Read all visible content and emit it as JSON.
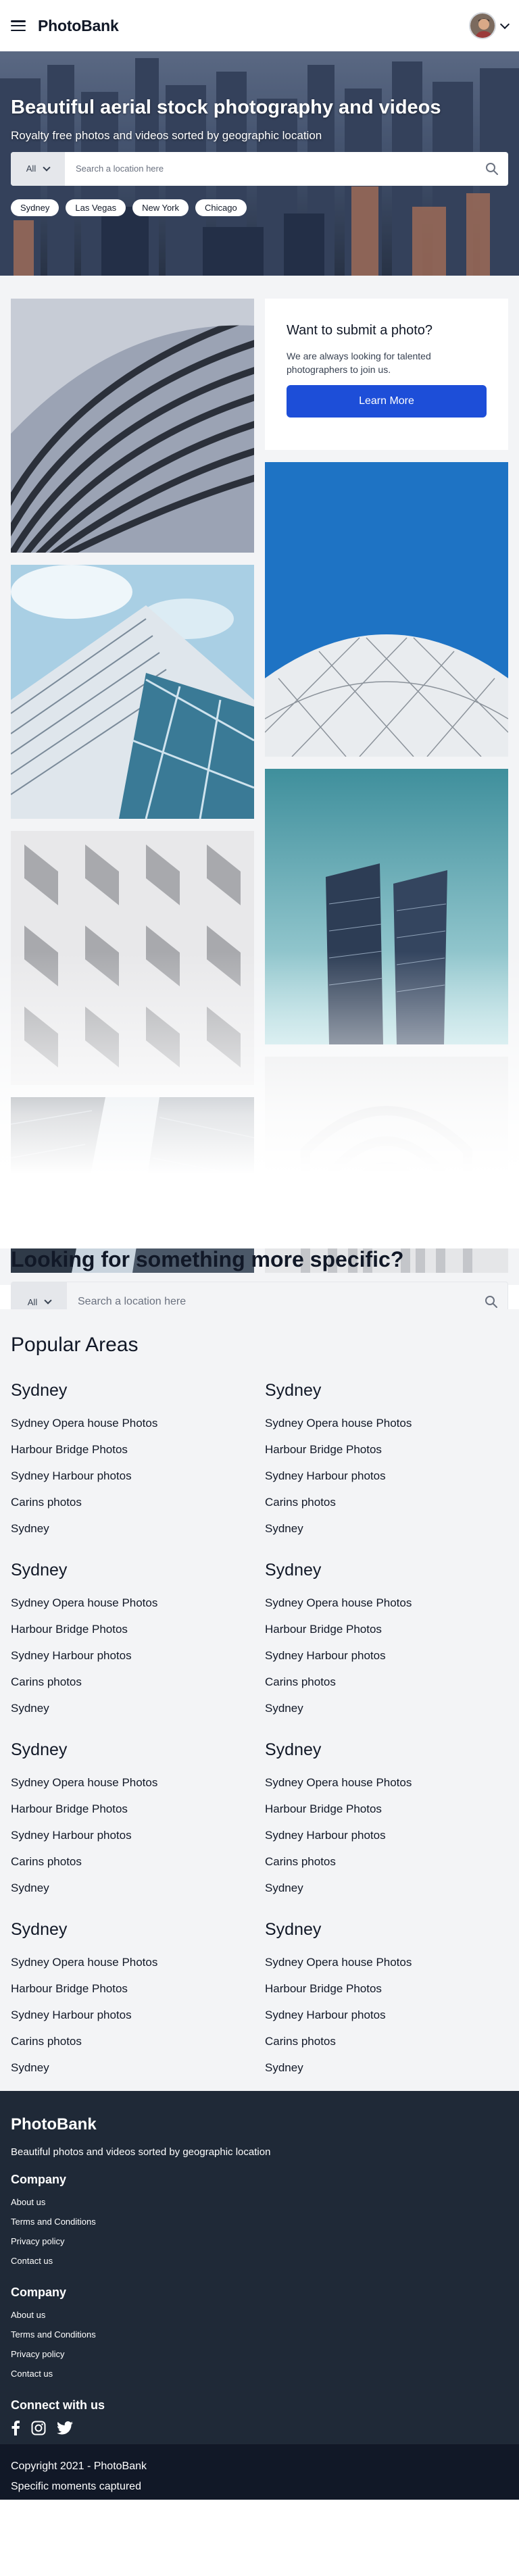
{
  "header": {
    "brand": "PhotoBank",
    "menu_icon": "hamburger-menu-icon",
    "avatar_icon": "user-avatar",
    "dropdown_icon": "chevron-down-icon"
  },
  "hero": {
    "title": "Beautiful aerial stock photography and videos",
    "subtitle": "Royalty free photos and videos sorted by geographic location",
    "search": {
      "category": "All",
      "placeholder": "Search a location here",
      "icon": "search-icon"
    },
    "chips": [
      "Sydney",
      "Las Vegas",
      "New York",
      "Chicago"
    ]
  },
  "promo": {
    "title": "Want to submit a photo?",
    "text": "We are always looking for talented photographers to join us.",
    "button": "Learn More"
  },
  "specific": {
    "title": "Looking for something more specific?",
    "category": "All",
    "placeholder": "Search a location here"
  },
  "popular": {
    "title": "Popular Areas",
    "areas": [
      {
        "name": "Sydney",
        "links": [
          "Sydney Opera house Photos",
          "Harbour Bridge Photos",
          "Sydney Harbour photos",
          "Carins photos",
          "Sydney"
        ]
      },
      {
        "name": "Sydney",
        "links": [
          "Sydney Opera house Photos",
          "Harbour Bridge Photos",
          "Sydney Harbour photos",
          "Carins photos",
          "Sydney"
        ]
      },
      {
        "name": "Sydney",
        "links": [
          "Sydney Opera house Photos",
          "Harbour Bridge Photos",
          "Sydney Harbour photos",
          "Carins photos",
          "Sydney"
        ]
      },
      {
        "name": "Sydney",
        "links": [
          "Sydney Opera house Photos",
          "Harbour Bridge Photos",
          "Sydney Harbour photos",
          "Carins photos",
          "Sydney"
        ]
      },
      {
        "name": "Sydney",
        "links": [
          "Sydney Opera house Photos",
          "Harbour Bridge Photos",
          "Sydney Harbour photos",
          "Carins photos",
          "Sydney"
        ]
      },
      {
        "name": "Sydney",
        "links": [
          "Sydney Opera house Photos",
          "Harbour Bridge Photos",
          "Sydney Harbour photos",
          "Carins photos",
          "Sydney"
        ]
      },
      {
        "name": "Sydney",
        "links": [
          "Sydney Opera house Photos",
          "Harbour Bridge Photos",
          "Sydney Harbour photos",
          "Carins photos",
          "Sydney"
        ]
      },
      {
        "name": "Sydney",
        "links": [
          "Sydney Opera house Photos",
          "Harbour Bridge Photos",
          "Sydney Harbour photos",
          "Carins photos",
          "Sydney"
        ]
      }
    ]
  },
  "footer": {
    "brand": "PhotoBank",
    "tagline": "Beautiful photos and videos sorted by geographic location",
    "columns": [
      {
        "title": "Company",
        "links": [
          "About us",
          "Terms and Conditions",
          "Privacy policy",
          "Contact us"
        ]
      },
      {
        "title": "Company",
        "links": [
          "About us",
          "Terms and Conditions",
          "Privacy policy",
          "Contact us"
        ]
      }
    ],
    "social_title": "Connect with us",
    "social_icons": [
      "facebook-icon",
      "instagram-icon",
      "twitter-icon"
    ],
    "copyright": "Copyright 2021 - PhotoBank",
    "motto": "Specific moments captured"
  },
  "colors": {
    "accent": "#1d4ed8",
    "footer_bg": "#1f2937",
    "footer_bottom_bg": "#111827",
    "section_bg": "#f3f4f6"
  }
}
